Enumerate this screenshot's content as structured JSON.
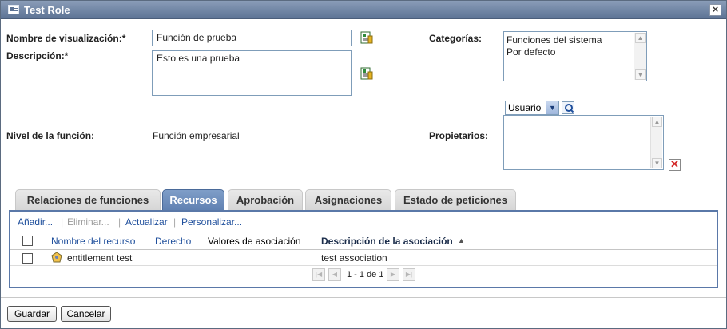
{
  "window": {
    "title": "Test Role",
    "close_label": "×"
  },
  "form": {
    "display_name_label": "Nombre de visualización:*",
    "display_name_value": "Función de prueba",
    "description_label": "Descripción:*",
    "description_value": "Esto es una prueba",
    "level_label": "Nivel de la función:",
    "level_value": "Función empresarial",
    "categories_label": "Categorías:",
    "categories": [
      "Funciones del sistema",
      "Por defecto"
    ],
    "owners_label": "Propietarios:",
    "owner_type_selected": "Usuario",
    "owners": []
  },
  "tabs": [
    {
      "label": "Relaciones de funciones",
      "active": false
    },
    {
      "label": "Recursos",
      "active": true
    },
    {
      "label": "Aprobación",
      "active": false
    },
    {
      "label": "Asignaciones",
      "active": false
    },
    {
      "label": "Estado de peticiones",
      "active": false
    }
  ],
  "toolbar": {
    "add": "Añadir...",
    "remove": "Eliminar...",
    "refresh": "Actualizar",
    "customize": "Personalizar...",
    "separator": "|"
  },
  "table": {
    "columns": {
      "resource_name": "Nombre del recurso",
      "right": "Derecho",
      "association_values": "Valores de asociación",
      "association_description": "Descripción de la asociación"
    },
    "sort_indicator": "▲",
    "rows": [
      {
        "resource_name": "entitlement test",
        "right": "",
        "association_values": "",
        "association_description": "test association"
      }
    ],
    "pager": {
      "text": "1 - 1 de 1"
    }
  },
  "buttons": {
    "save": "Guardar",
    "cancel": "Cancelar"
  },
  "colors": {
    "accent": "#5f80b1",
    "link": "#1f4f9c",
    "title_bar": "#5d7395"
  }
}
